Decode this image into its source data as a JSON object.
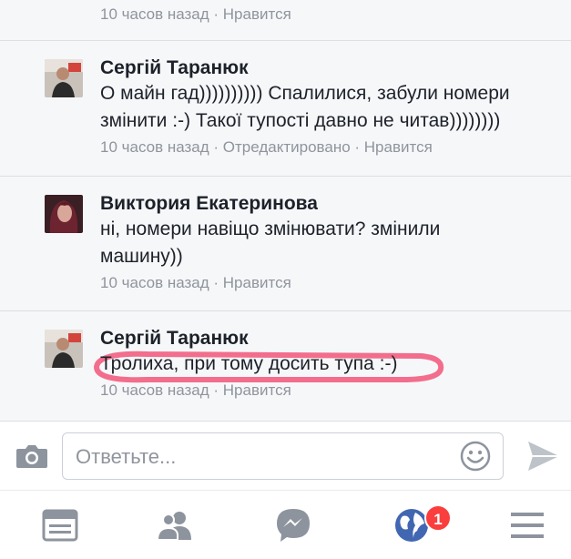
{
  "feed": {
    "top_meta": {
      "time": "10 часов назад",
      "like": "Нравится"
    },
    "comments": [
      {
        "author": "Сергій Таранюк",
        "text_lines": [
          "О майн гад)))))))))) Спалилися, забули номери",
          "змінити :-) Такої тупості давно не читав))))))))"
        ],
        "time": "10 часов назад",
        "edited": "Отредактировано",
        "like": "Нравится"
      },
      {
        "author": "Виктория Екатеринова",
        "text_lines": [
          "ні, номери навіщо змінювати? змінили",
          "машину))"
        ],
        "time": "10 часов назад",
        "like": "Нравится"
      },
      {
        "author": "Сергій Таранюк",
        "text_lines": [
          "Тролиха, при тому досить тупа :-)"
        ],
        "time": "10 часов назад",
        "like": "Нравится",
        "highlight_color": "#f2557a"
      }
    ],
    "separator": " · "
  },
  "reply": {
    "placeholder": "Ответьте..."
  },
  "tabbar": {
    "icons": [
      "news-feed-icon",
      "friends-icon",
      "messenger-icon",
      "notifications-globe-icon",
      "menu-icon"
    ],
    "notification_badge": "1"
  },
  "colors": {
    "accent": "#4267b2",
    "muted": "#90949c",
    "badge": "#fa3e3e"
  }
}
